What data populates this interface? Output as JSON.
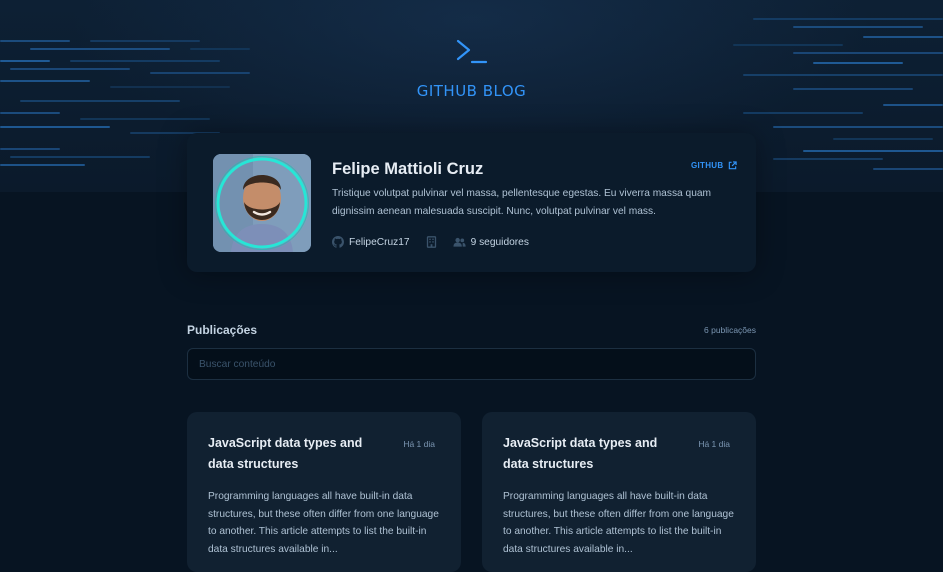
{
  "header": {
    "brand": "GITHUB BLOG",
    "logo_icon": "terminal-prompt-icon",
    "accent_color": "#3294f8"
  },
  "profile": {
    "name": "Felipe Mattioli Cruz",
    "link_label": "GITHUB",
    "bio": "Tristique volutpat pulvinar vel massa, pellentesque egestas. Eu viverra massa quam dignissim aenean malesuada suscipit. Nunc, volutpat pulvinar vel mass.",
    "username": "FelipeCruz17",
    "followers": "9 seguidores",
    "icons": [
      "github-icon",
      "building-icon",
      "users-icon",
      "external-link-icon"
    ]
  },
  "publications": {
    "title": "Publicações",
    "count": "6 publicações",
    "search_placeholder": "Buscar conteúdo"
  },
  "posts": [
    {
      "title": "JavaScript data types and data structures",
      "date": "Há 1 dia",
      "excerpt": "Programming languages all have built-in data structures, but these often differ from one language to another. This article attempts to list the built-in data structures available in..."
    },
    {
      "title": "JavaScript data types and data structures",
      "date": "Há 1 dia",
      "excerpt": "Programming languages all have built-in data structures, but these often differ from one language to another. This article attempts to list the built-in data structures available in..."
    }
  ]
}
